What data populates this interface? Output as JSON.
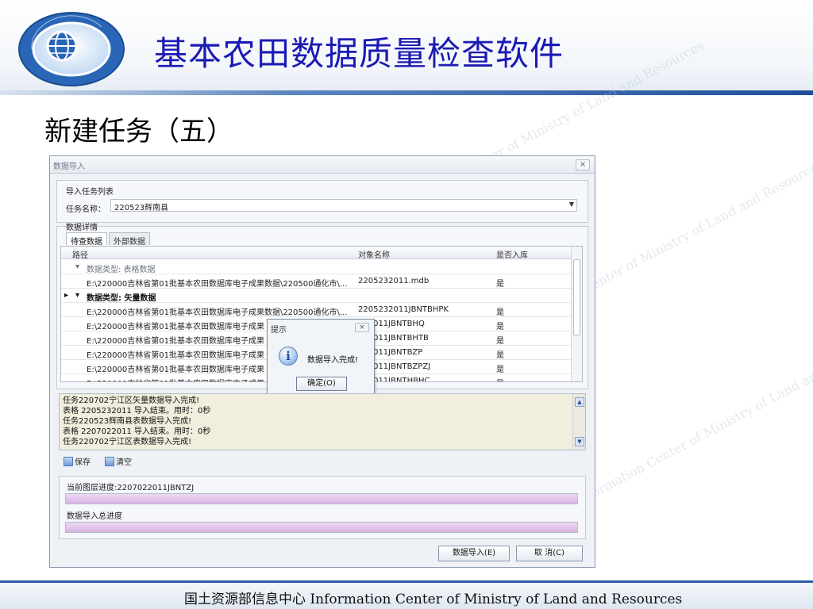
{
  "header": {
    "app_title": "基本农田数据质量检查软件",
    "logo_text": "ICMLR",
    "logo_ring_text": "国土资源部信息中心"
  },
  "slide_title": "新建任务（五）",
  "dialog": {
    "title": "数据导入",
    "close": "×",
    "task_list_label": "导入任务列表",
    "task_name_label": "任务名称：",
    "task_name_value": "220523辉南县",
    "details_label": "数据详情",
    "tabs": [
      "待查数据",
      "外部数据"
    ],
    "grid": {
      "headers": [
        "路径",
        "对象名称",
        "是否入库"
      ],
      "rows": [
        {
          "type": "group",
          "path": "数据类型: 表格数据",
          "name": "",
          "flag": ""
        },
        {
          "type": "data",
          "path": "E:\\220000吉林省第01批基本农田数据库电子成果数据\\220500通化市\\...",
          "name": "2205232011.mdb",
          "flag": "是"
        },
        {
          "type": "group-bold",
          "path": "数据类型: 矢量数据",
          "name": "",
          "flag": ""
        },
        {
          "type": "data",
          "path": "E:\\220000吉林省第01批基本农田数据库电子成果数据\\220500通化市\\...",
          "name": "2205232011JBNTBHPK",
          "flag": "是"
        },
        {
          "type": "data",
          "path": "E:\\220000吉林省第01批基本农田数据库电子成果",
          "name": "232011JBNTBHQ",
          "flag": "是"
        },
        {
          "type": "data",
          "path": "E:\\220000吉林省第01批基本农田数据库电子成果",
          "name": "232011JBNTBHTB",
          "flag": "是"
        },
        {
          "type": "data",
          "path": "E:\\220000吉林省第01批基本农田数据库电子成果",
          "name": "232011JBNTBZP",
          "flag": "是"
        },
        {
          "type": "data",
          "path": "E:\\220000吉林省第01批基本农田数据库电子成果",
          "name": "232011JBNTBZPZJ",
          "flag": "是"
        },
        {
          "type": "data",
          "path": "E:\\220000吉林省第01批基本农田数据库电子成果",
          "name": "232011JBNTHBHC",
          "flag": "是"
        }
      ]
    },
    "msgbox": {
      "title": "提示",
      "close": "×",
      "icon": "info-icon",
      "text": "数据导入完成!",
      "ok": "确定(O)"
    },
    "log": [
      "任务220702宁江区矢量数据导入完成!",
      "表格 2205232011 导入结束。用时：0秒",
      "任务220523辉南县表数据导入完成!",
      "表格 2207022011 导入结束。用时：0秒",
      "任务220702宁江区表数据导入完成!"
    ],
    "toolbar": {
      "save": "保存",
      "clear": "清空"
    },
    "current_layer_progress": "当前图层进度:2207022011JBNTZJ",
    "total_progress_label": "数据导入总进度",
    "current_progress_value": 1.0,
    "total_progress_value": 1.0,
    "import_button": "数据导入(E)",
    "cancel_button": "取 消(C)"
  },
  "watermark": [
    "Information Center of Ministry of Land and Resources",
    "国土资源部信息中心"
  ],
  "footer": {
    "text": "国土资源部信息中心  Information Center of Ministry of Land and Resources"
  }
}
